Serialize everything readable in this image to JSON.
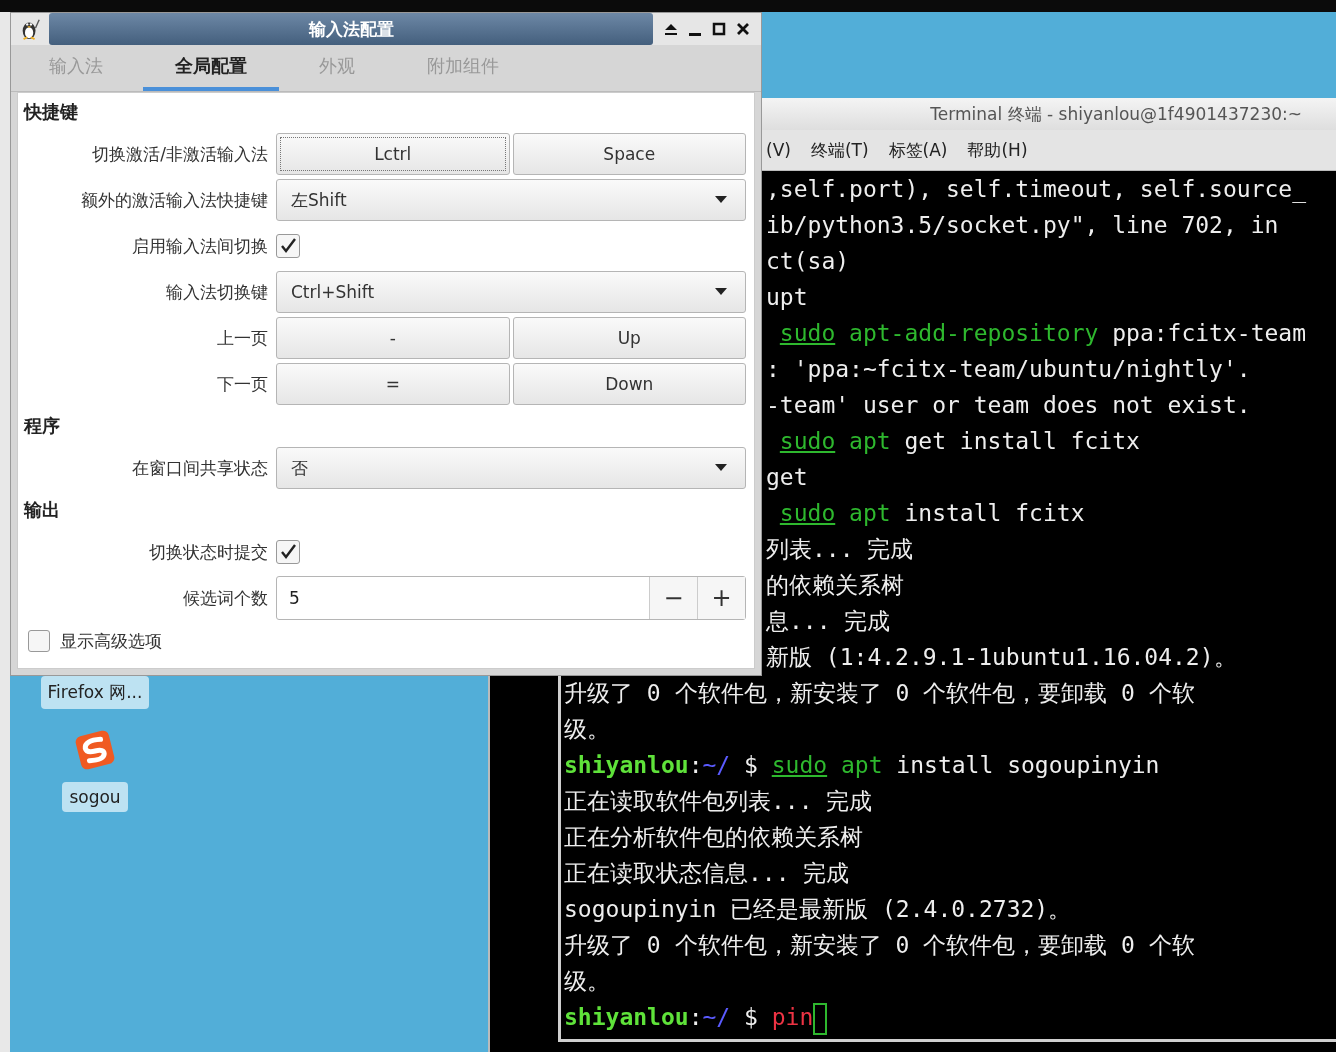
{
  "desktop": {
    "icons": [
      {
        "kind": "browser",
        "label": "Firefox 网..."
      },
      {
        "kind": "sogou",
        "label": "sogou"
      }
    ]
  },
  "terminal": {
    "title": "Terminal 终端 - shiyanlou@1f4901437230:~",
    "menu": [
      "(V)",
      "终端(T)",
      "标签(A)",
      "帮助(H)"
    ],
    "clipped_lines": [
      {
        "segments": [
          {
            "kind": "text",
            "text": ",self.port), self.timeout, self.source_"
          }
        ]
      },
      {
        "segments": [
          {
            "kind": "text",
            "text": "ib/python3.5/socket.py\", line 702, in"
          }
        ]
      },
      {
        "segments": [
          {
            "kind": "text",
            "text": "ct(sa)"
          }
        ]
      },
      {
        "segments": [
          {
            "kind": "text",
            "text": "upt"
          }
        ]
      },
      {
        "segments": [
          {
            "kind": "sudo",
            "text": "sudo"
          },
          {
            "kind": "cmd",
            "text": " apt-add-repository"
          },
          {
            "kind": "text",
            "text": " ppa:fcitx-team"
          }
        ]
      },
      {
        "segments": [
          {
            "kind": "text",
            "text": ": 'ppa:~fcitx-team/ubuntu/nightly'."
          }
        ]
      },
      {
        "segments": [
          {
            "kind": "text",
            "text": "-team' user or team does not exist."
          }
        ]
      },
      {
        "segments": [
          {
            "kind": "sudo",
            "text": "sudo"
          },
          {
            "kind": "cmd",
            "text": " apt"
          },
          {
            "kind": "text",
            "text": " get install fcitx"
          }
        ]
      },
      {
        "segments": [
          {
            "kind": "text",
            "text": "get"
          }
        ]
      },
      {
        "segments": [
          {
            "kind": "sudo",
            "text": "sudo"
          },
          {
            "kind": "cmd",
            "text": " apt"
          },
          {
            "kind": "text",
            "text": " install fcitx"
          }
        ]
      },
      {
        "segments": [
          {
            "kind": "text",
            "text": "列表... 完成"
          }
        ]
      },
      {
        "segments": [
          {
            "kind": "text",
            "text": "的依赖关系树"
          }
        ]
      },
      {
        "segments": [
          {
            "kind": "text",
            "text": "息... 完成"
          }
        ]
      },
      {
        "segments": [
          {
            "kind": "text",
            "text": "新版 (1:4.2.9.1-1ubuntu1.16.04.2)。"
          }
        ]
      }
    ],
    "lines": [
      {
        "segments": [
          {
            "kind": "text",
            "text": "升级了 0 个软件包，新安装了 0 个软件包，要卸载 0 个软"
          }
        ]
      },
      {
        "segments": [
          {
            "kind": "text",
            "text": "级。"
          }
        ]
      },
      {
        "segments": [
          {
            "kind": "prompt",
            "text": "shiyanlou"
          },
          {
            "kind": "text",
            "text": ":"
          },
          {
            "kind": "path",
            "text": "~/"
          },
          {
            "kind": "text",
            "text": " $"
          },
          {
            "kind": "sudo",
            "text": "sudo"
          },
          {
            "kind": "cmd",
            "text": " apt"
          },
          {
            "kind": "text",
            "text": " install sogoupinyin"
          }
        ]
      },
      {
        "segments": [
          {
            "kind": "text",
            "text": "正在读取软件包列表... 完成"
          }
        ]
      },
      {
        "segments": [
          {
            "kind": "text",
            "text": "正在分析软件包的依赖关系树"
          }
        ]
      },
      {
        "segments": [
          {
            "kind": "text",
            "text": "正在读取状态信息... 完成"
          }
        ]
      },
      {
        "segments": [
          {
            "kind": "text",
            "text": "sogoupinyin 已经是最新版 (2.4.0.2732)。"
          }
        ]
      },
      {
        "segments": [
          {
            "kind": "text",
            "text": "升级了 0 个软件包，新安装了 0 个软件包，要卸载 0 个软"
          }
        ]
      },
      {
        "segments": [
          {
            "kind": "text",
            "text": "级。"
          }
        ]
      },
      {
        "cursor": true,
        "segments": [
          {
            "kind": "prompt",
            "text": "shiyanlou"
          },
          {
            "kind": "text",
            "text": ":"
          },
          {
            "kind": "path",
            "text": "~/"
          },
          {
            "kind": "text",
            "text": " $ "
          },
          {
            "kind": "typed",
            "text": "pin"
          }
        ]
      }
    ]
  },
  "dialog": {
    "title": "输入法配置",
    "tabs": [
      {
        "label": "输入法",
        "selected": false
      },
      {
        "label": "全局配置",
        "selected": true
      },
      {
        "label": "外观",
        "selected": false
      },
      {
        "label": "附加组件",
        "selected": false
      }
    ],
    "sections": [
      {
        "title": "快捷键",
        "rows": [
          {
            "kind": "keys",
            "label": "切换激活/非激活输入法",
            "keys": [
              "Lctrl",
              "Space"
            ]
          },
          {
            "kind": "dropdown",
            "label": "额外的激活输入法快捷键",
            "value": "左Shift"
          },
          {
            "kind": "checkbox",
            "label": "启用输入法间切换",
            "checked": true
          },
          {
            "kind": "dropdown",
            "label": "输入法切换键",
            "value": "Ctrl+Shift"
          },
          {
            "kind": "keys",
            "label": "上一页",
            "keys": [
              "-",
              "Up"
            ]
          },
          {
            "kind": "keys",
            "label": "下一页",
            "keys": [
              "=",
              "Down"
            ]
          }
        ]
      },
      {
        "title": "程序",
        "rows": [
          {
            "kind": "dropdown",
            "label": "在窗口间共享状态",
            "value": "否"
          }
        ]
      },
      {
        "title": "输出",
        "rows": [
          {
            "kind": "checkbox",
            "label": "切换状态时提交",
            "checked": true
          },
          {
            "kind": "spin",
            "label": "候选词个数",
            "value": "5",
            "buttons": [
              "−",
              "+"
            ]
          }
        ]
      }
    ],
    "advanced": {
      "label": "显示高级选项",
      "checked": false
    }
  }
}
